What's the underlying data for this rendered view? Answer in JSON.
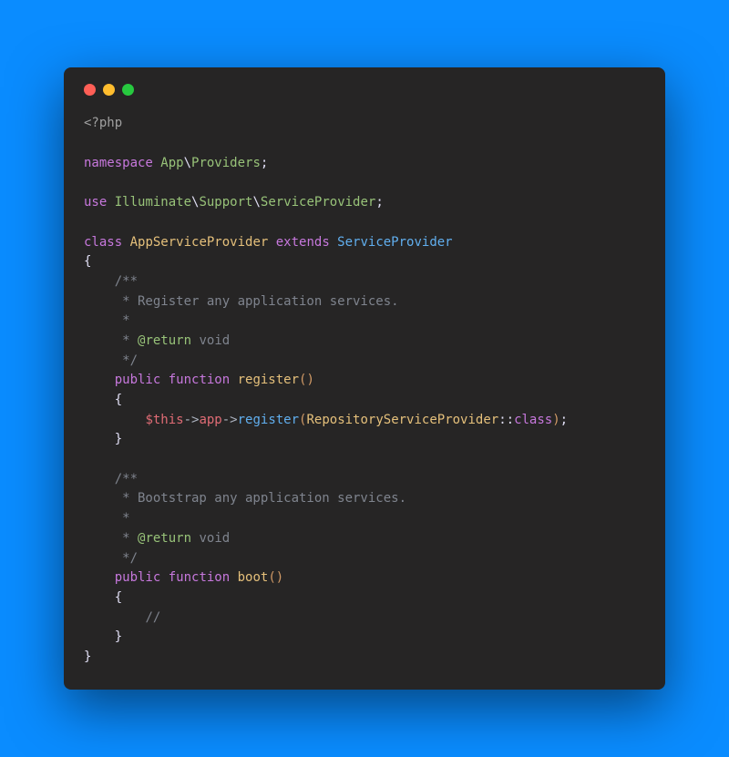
{
  "code": {
    "line1_open": "<?php",
    "line3_kw": "namespace",
    "line3_ns1": " App",
    "line3_bs": "\\",
    "line3_ns2": "Providers",
    "line3_semi": ";",
    "line5_kw": "use",
    "line5_ns1": " Illuminate",
    "line5_bs1": "\\",
    "line5_ns2": "Support",
    "line5_bs2": "\\",
    "line5_ns3": "ServiceProvider",
    "line5_semi": ";",
    "line7_kw1": "class",
    "line7_class": " AppServiceProvider",
    "line7_kw2": " extends",
    "line7_parent": " ServiceProvider",
    "line8_brace": "{",
    "line9_c": "    /**",
    "line10_c": "     * Register any application services.",
    "line11_c": "     *",
    "line12_c1": "     * ",
    "line12_c2": "@return",
    "line12_c3": " void",
    "line13_c": "     */",
    "line14_indent": "    ",
    "line14_kw1": "public",
    "line14_kw2": " function",
    "line14_fn": " register",
    "line14_paren": "()",
    "line15_brace": "    {",
    "line16_indent": "        ",
    "line16_this": "$this",
    "line16_arr1": "->",
    "line16_app": "app",
    "line16_arr2": "->",
    "line16_reg": "register",
    "line16_po": "(",
    "line16_cls": "RepositoryServiceProvider",
    "line16_dcol": "::",
    "line16_class": "class",
    "line16_pc": ")",
    "line16_semi": ";",
    "line17_brace": "    }",
    "line19_c": "    /**",
    "line20_c": "     * Bootstrap any application services.",
    "line21_c": "     *",
    "line22_c1": "     * ",
    "line22_c2": "@return",
    "line22_c3": " void",
    "line23_c": "     */",
    "line24_indent": "    ",
    "line24_kw1": "public",
    "line24_kw2": " function",
    "line24_fn": " boot",
    "line24_paren": "()",
    "line25_brace": "    {",
    "line26_indent": "        ",
    "line26_c": "//",
    "line27_brace": "    }",
    "line28_brace": "}"
  }
}
